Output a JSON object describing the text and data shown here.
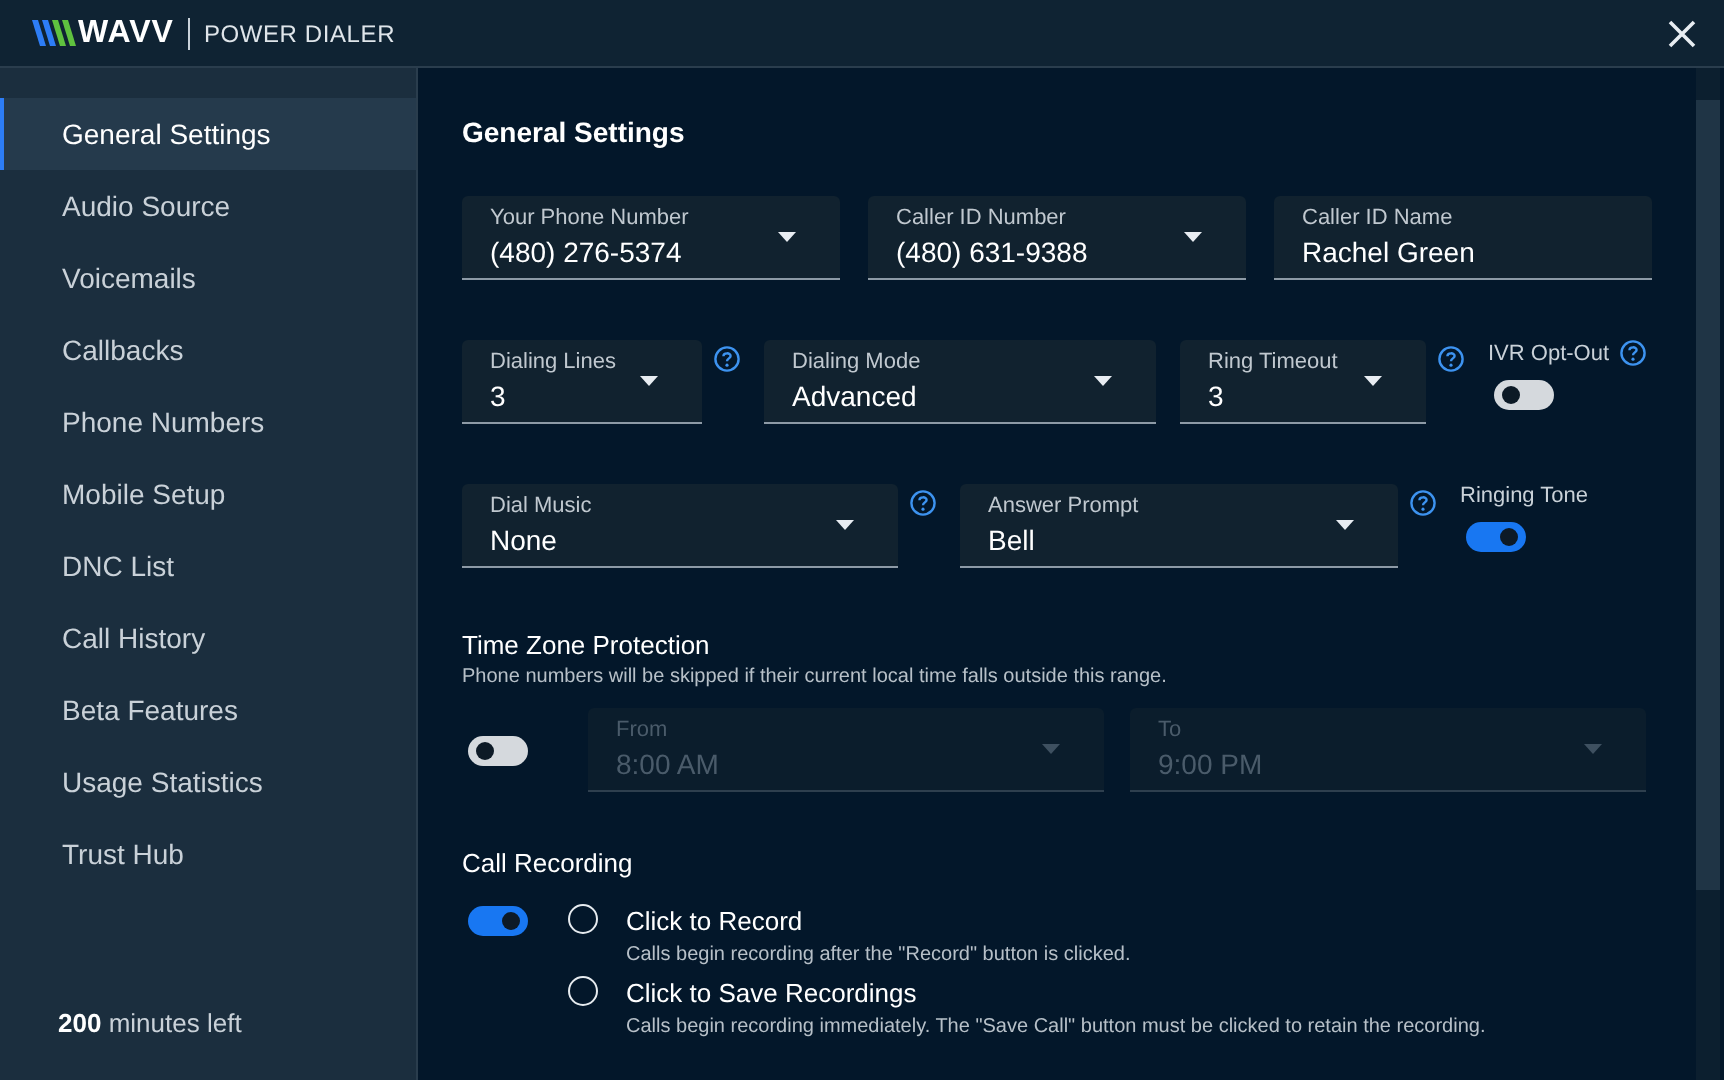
{
  "header": {
    "logo": "WAVV",
    "product": "POWER DIALER"
  },
  "sidebar": {
    "items": [
      {
        "label": "General Settings",
        "selected": true
      },
      {
        "label": "Audio Source",
        "selected": false
      },
      {
        "label": "Voicemails",
        "selected": false
      },
      {
        "label": "Callbacks",
        "selected": false
      },
      {
        "label": "Phone Numbers",
        "selected": false
      },
      {
        "label": "Mobile Setup",
        "selected": false
      },
      {
        "label": "DNC List",
        "selected": false
      },
      {
        "label": "Call History",
        "selected": false
      },
      {
        "label": "Beta Features",
        "selected": false
      },
      {
        "label": "Usage Statistics",
        "selected": false
      },
      {
        "label": "Trust Hub",
        "selected": false
      }
    ],
    "minutes": {
      "count": "200",
      "label": "minutes left"
    }
  },
  "main": {
    "title": "General Settings",
    "fields": [
      {
        "kind": "select",
        "label": "Your Phone Number",
        "value": "(480) 276-5374",
        "help": false
      },
      {
        "kind": "select",
        "label": "Caller ID Number",
        "value": "(480) 631-9388",
        "help": false
      },
      {
        "kind": "text",
        "label": "Caller ID Name",
        "value": "Rachel Green",
        "help": false
      },
      {
        "kind": "select",
        "label": "Dialing Lines",
        "value": "3",
        "help": true
      },
      {
        "kind": "select",
        "label": "Dialing Mode",
        "value": "Advanced",
        "help": false
      },
      {
        "kind": "select",
        "label": "Ring Timeout",
        "value": "3",
        "help": true
      },
      {
        "kind": "toggle",
        "label": "IVR Opt-Out",
        "on": false,
        "help": true
      },
      {
        "kind": "select",
        "label": "Dial Music",
        "value": "None",
        "help": true
      },
      {
        "kind": "select",
        "label": "Answer Prompt",
        "value": "Bell",
        "help": true
      },
      {
        "kind": "toggle",
        "label": "Ringing Tone",
        "on": true,
        "help": false
      }
    ]
  },
  "time_zone": {
    "title": "Time Zone Protection",
    "description": "Phone numbers will be skipped if their current local time falls outside this range.",
    "enabled": false,
    "from": {
      "label": "From",
      "value": "8:00 AM"
    },
    "to": {
      "label": "To",
      "value": "9:00 PM"
    }
  },
  "call_recording": {
    "title": "Call Recording",
    "enabled": true,
    "options": [
      {
        "label": "Click to Record",
        "description": "Calls begin recording after the \"Record\" button is clicked.",
        "selected": false
      },
      {
        "label": "Click to Save Recordings",
        "description": "Calls begin recording immediately. The \"Save Call\" button must be clicked to retain the recording.",
        "selected": false
      }
    ]
  }
}
